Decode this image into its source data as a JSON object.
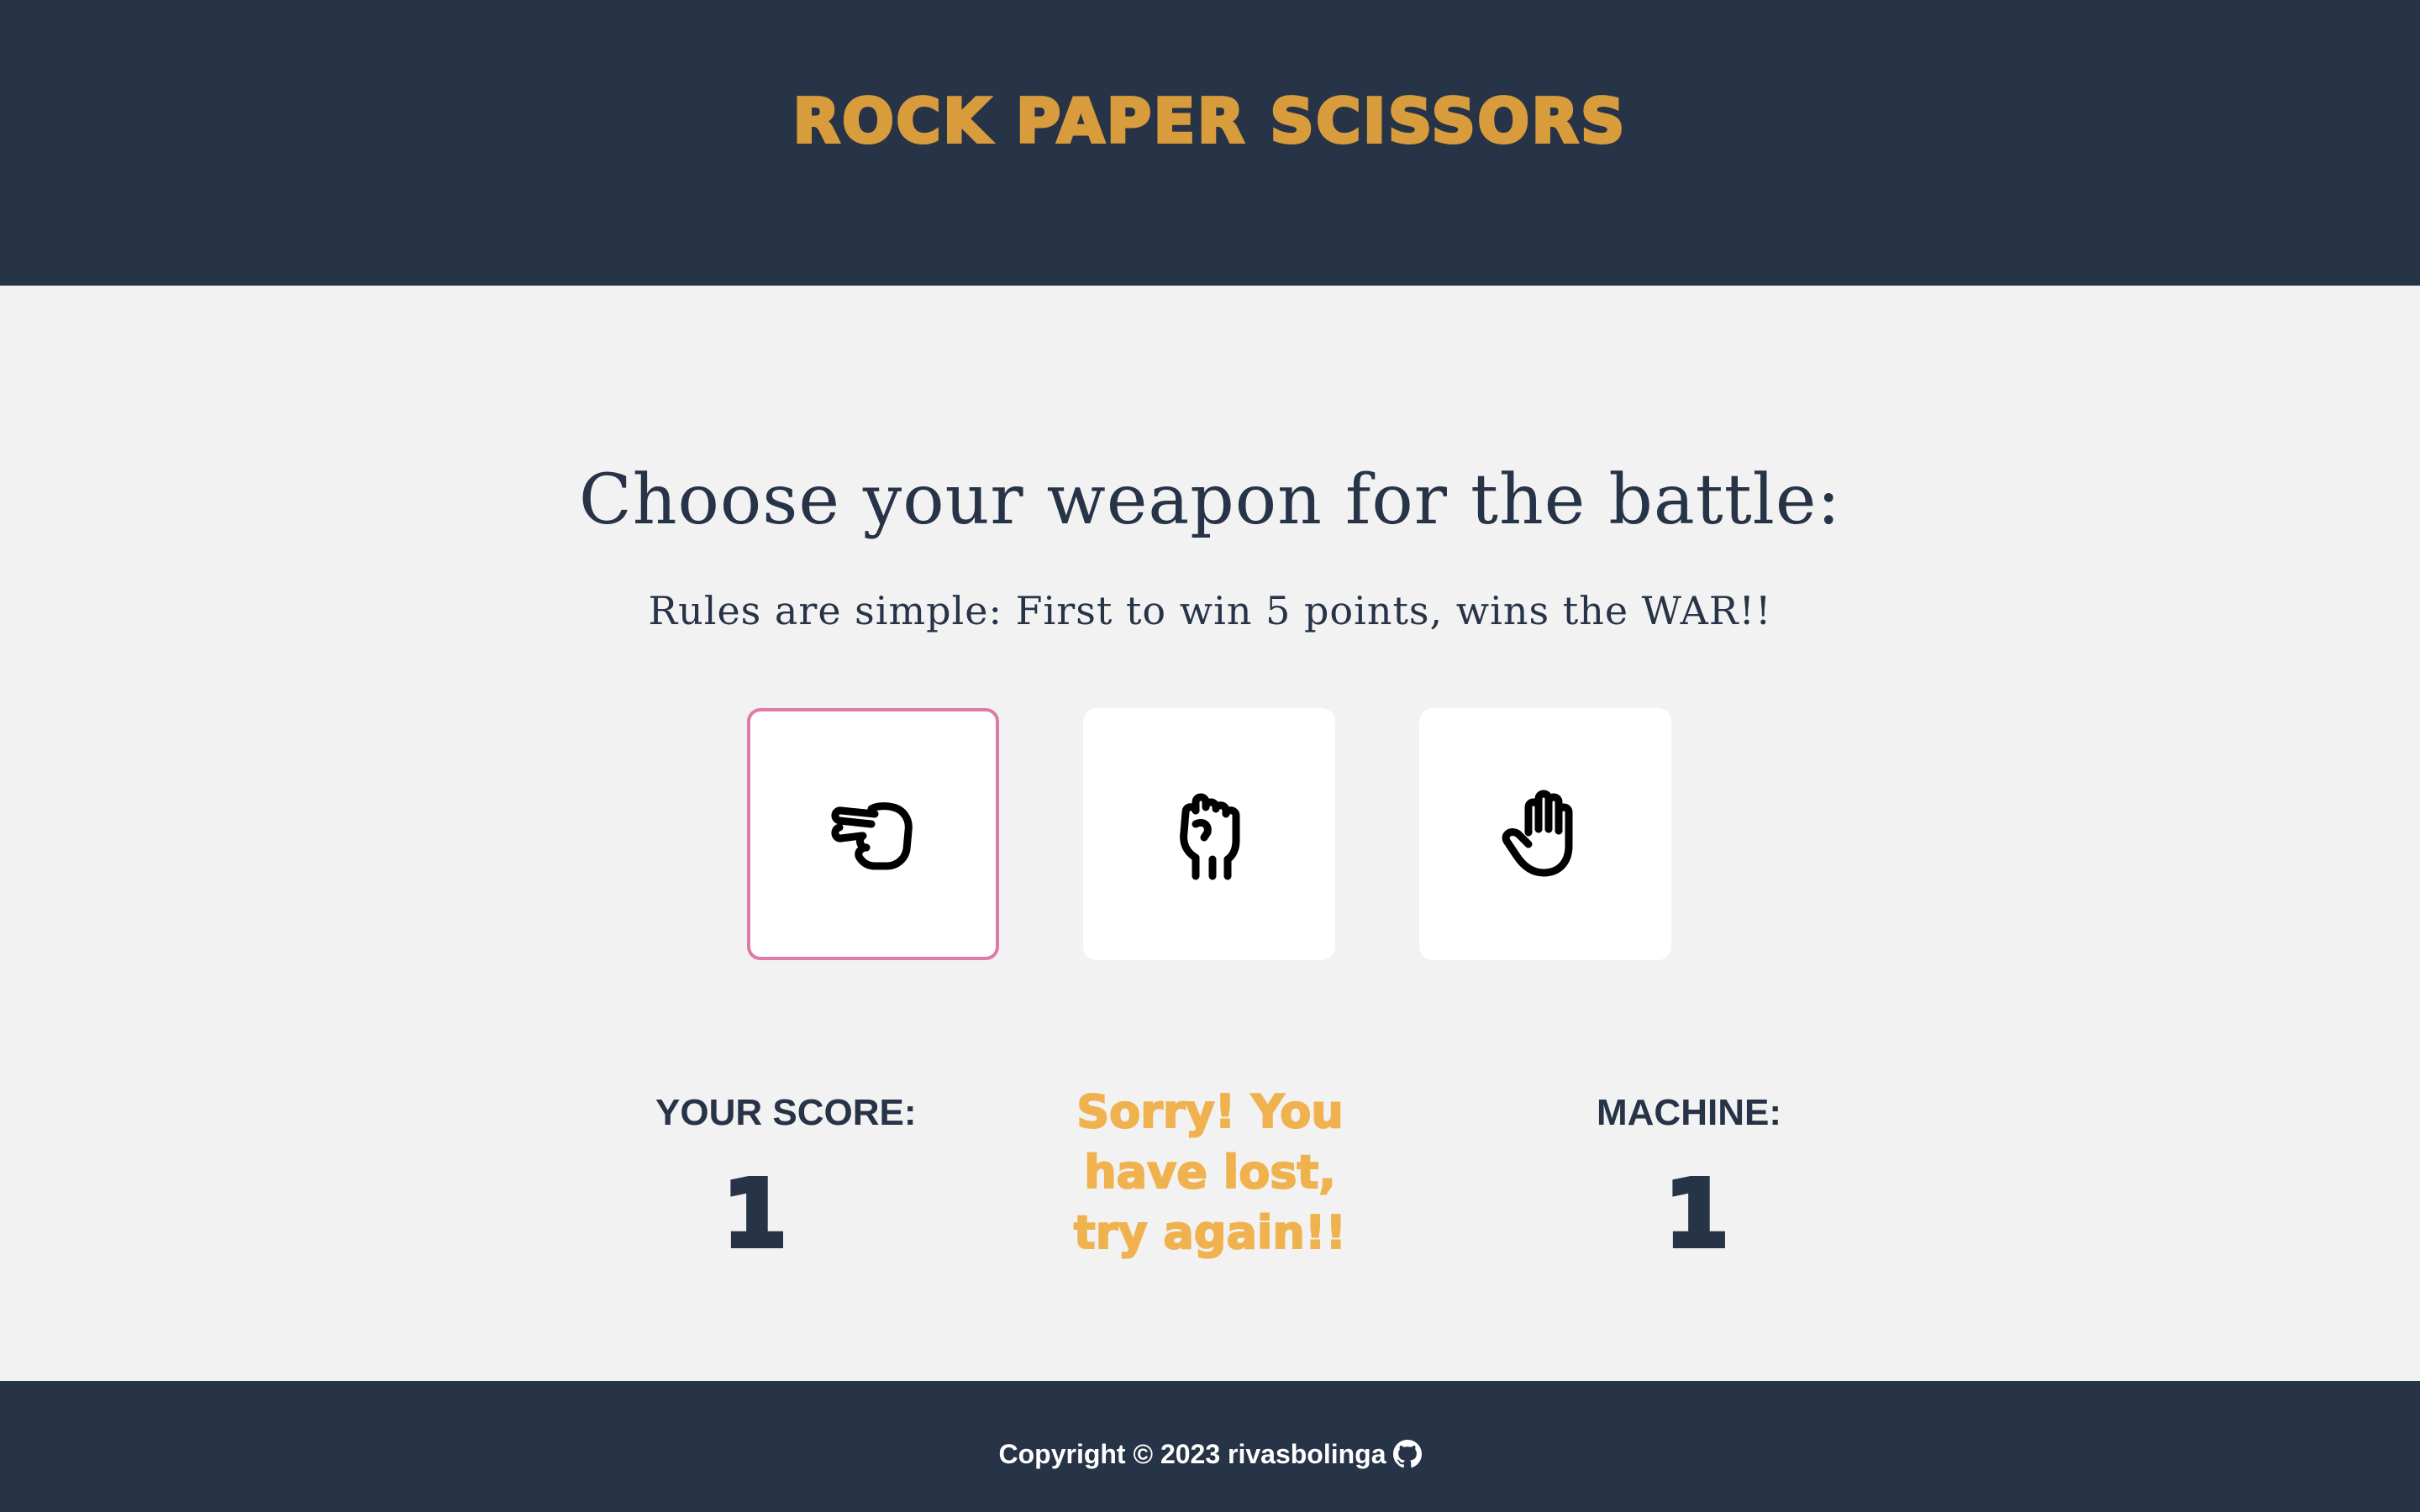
{
  "header": {
    "title": "ROCK PAPER SCISSORS"
  },
  "main": {
    "heading": "Choose your weapon for the battle:",
    "rules": "Rules are simple: First to win 5 points, wins the WAR!!",
    "choices": [
      {
        "icon": "scissors-hand-icon",
        "selected": true
      },
      {
        "icon": "rock-fist-icon",
        "selected": false
      },
      {
        "icon": "paper-hand-icon",
        "selected": false
      }
    ]
  },
  "score": {
    "player_label": "YOUR SCORE:",
    "player_value": "1",
    "machine_label": "MACHINE:",
    "machine_value": "1",
    "result_message": "Sorry! You have lost, try again!!"
  },
  "footer": {
    "copyright": "Copyright © 2023 rivasbolinga",
    "icon": "github-icon"
  },
  "colors": {
    "dark": "#273447",
    "title_orange": "#d89c3c",
    "result_orange": "#f0b24f",
    "selected_border": "#e07aa7",
    "background": "#f2f2f2"
  }
}
